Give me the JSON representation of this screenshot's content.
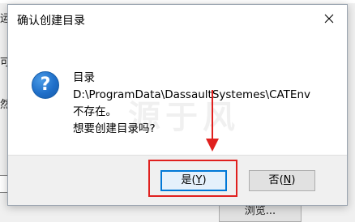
{
  "dialog": {
    "title": "确认创建目录",
    "icon": "question-icon",
    "message": {
      "line1": "目录",
      "line2": "D:\\ProgramData\\DassaultSystemes\\CATEnv",
      "line3": "不存在。",
      "line4": "想要创建目录吗?"
    },
    "buttons": {
      "yes_label": "是",
      "yes_key": "Y",
      "no_label": "否",
      "no_key": "N"
    }
  },
  "watermark": "源于风",
  "background": {
    "left_chars": [
      "运",
      "可",
      "然"
    ],
    "browse_label": "浏览..."
  },
  "annotation": {
    "highlight_color": "#e0201e"
  },
  "colors": {
    "accent": "#0078d7",
    "question_icon": "#1f6fc9"
  }
}
